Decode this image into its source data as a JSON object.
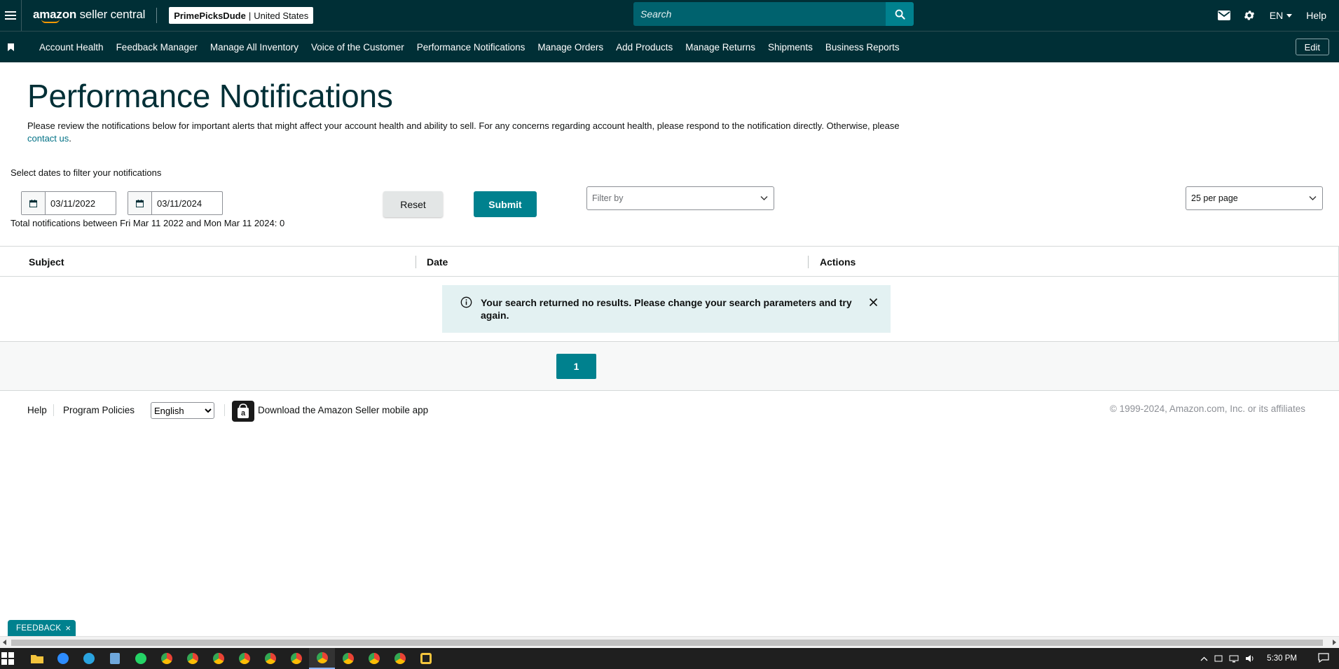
{
  "topbar": {
    "logo_bold": "amazon",
    "logo_rest": " seller central",
    "store_name": "PrimePicksDude",
    "store_sep": "|",
    "store_region": "United States",
    "search_placeholder": "Search",
    "language": "EN",
    "help": "Help"
  },
  "nav": {
    "items": [
      "Account Health",
      "Feedback Manager",
      "Manage All Inventory",
      "Voice of the Customer",
      "Performance Notifications",
      "Manage Orders",
      "Add Products",
      "Manage Returns",
      "Shipments",
      "Business Reports"
    ],
    "edit": "Edit"
  },
  "page": {
    "title": "Performance Notifications",
    "description": "Please review the notifications below for important alerts that might affect your account health and ability to sell. For any concerns regarding account health, please respond to the notification directly. Otherwise, please ",
    "contact_link": "contact us",
    "description_end": "."
  },
  "filters": {
    "label": "Select dates to filter your notifications",
    "start_date": "03/11/2022",
    "end_date": "03/11/2024",
    "total_line": "Total notifications between Fri Mar 11 2022 and Mon Mar 11 2024: 0",
    "reset": "Reset",
    "submit": "Submit",
    "filter_by_placeholder": "Filter by",
    "per_page": "25 per page"
  },
  "table": {
    "columns": [
      "Subject",
      "Date",
      "Actions"
    ],
    "empty_message": "Your search returned no results. Please change your search parameters and try again."
  },
  "pagination": {
    "current_page": "1"
  },
  "footer": {
    "help": "Help",
    "policies": "Program Policies",
    "language_selected": "English",
    "app_text": "Download the Amazon Seller mobile app",
    "copyright": "© 1999-2024, Amazon.com, Inc. or its affiliates"
  },
  "feedback": {
    "label": "FEEDBACK",
    "close": "×"
  },
  "taskbar": {
    "time": "5:30 PM"
  },
  "colors": {
    "header_bg": "#002f36",
    "accent": "#00818e",
    "alert_bg": "#e3f1f2",
    "link": "#007185"
  }
}
